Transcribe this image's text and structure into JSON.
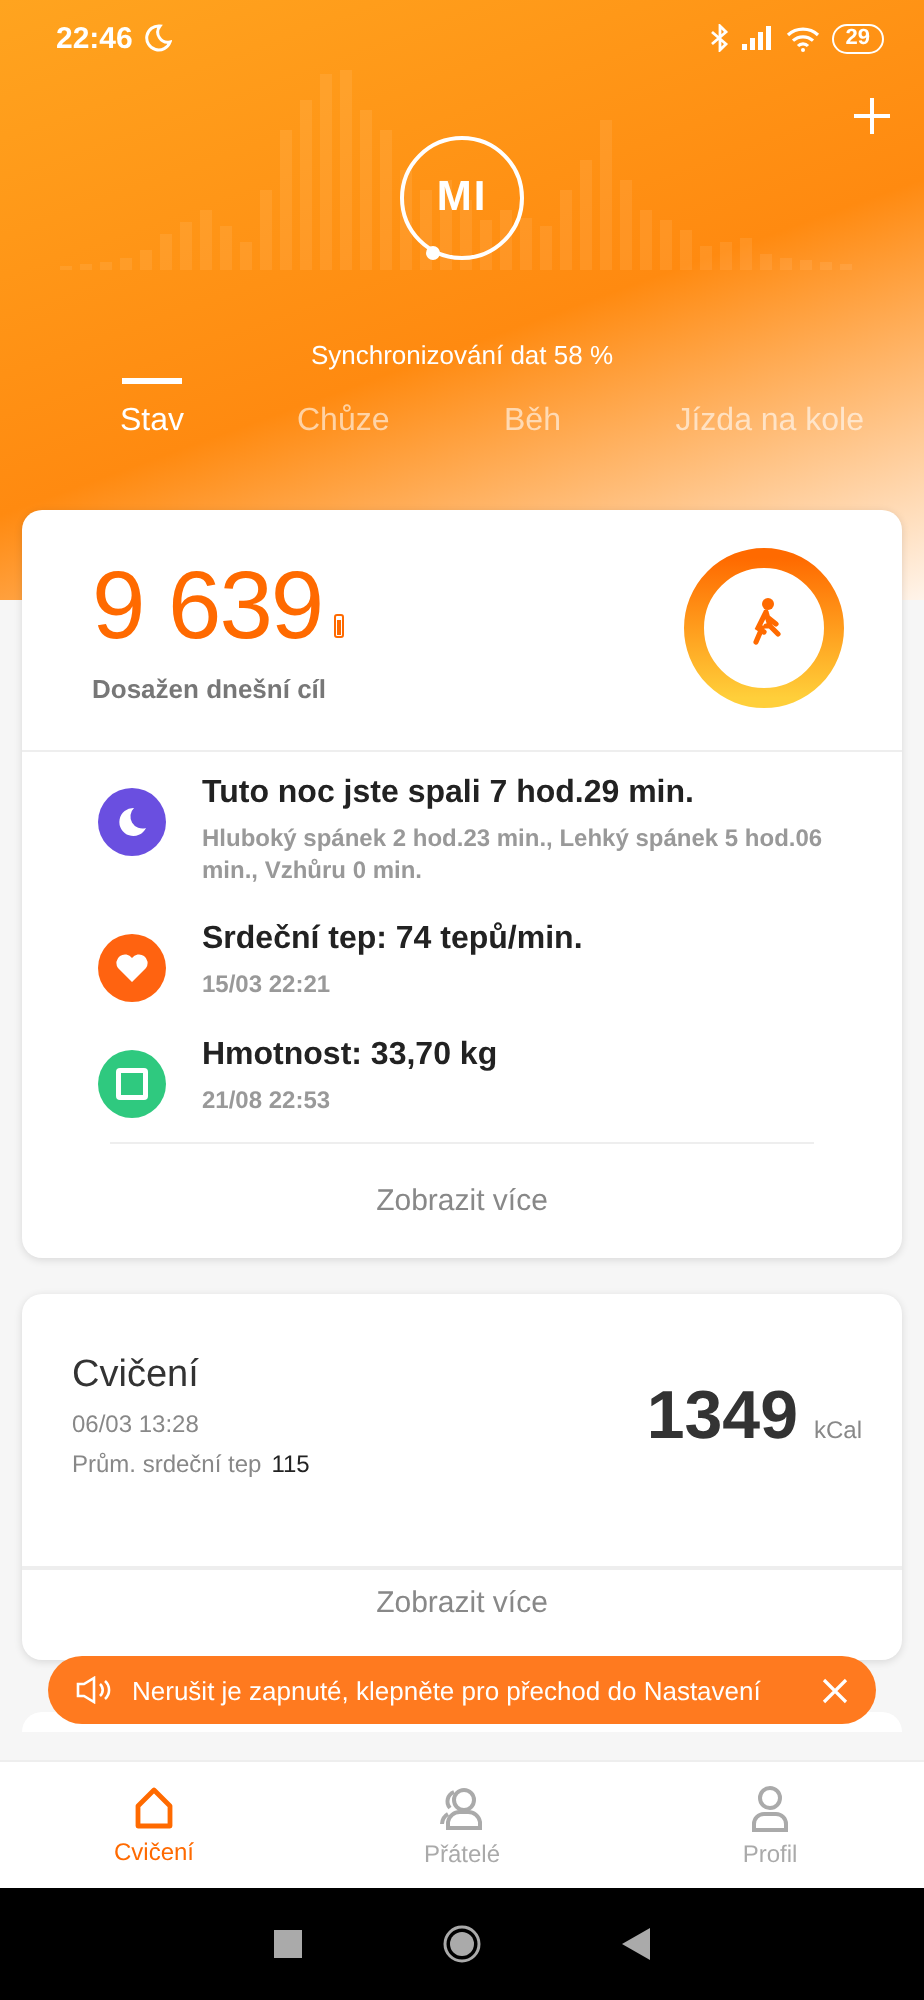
{
  "status_bar": {
    "time": "22:46",
    "battery": "29"
  },
  "header": {
    "logo": "MI",
    "sync_text": "Synchronizování dat 58 %"
  },
  "tabs": [
    {
      "label": "Stav",
      "selected": true
    },
    {
      "label": "Chůze",
      "selected": false
    },
    {
      "label": "Běh",
      "selected": false
    },
    {
      "label": "Jízda na kole",
      "selected": false
    }
  ],
  "steps_card": {
    "steps": "9 639",
    "goal_text": "Dosažen dnešní cíl",
    "items": [
      {
        "kind": "sleep",
        "color": "#6a4fe0",
        "title": "Tuto noc jste spali 7 hod.29 min.",
        "detail": "Hluboký spánek 2 hod.23 min., Lehký spánek 5 hod.06 min., Vzhůru 0 min."
      },
      {
        "kind": "heart",
        "color": "#ff6310",
        "title": "Srdeční tep: 74 tepů/min.",
        "detail": "15/03 22:21"
      },
      {
        "kind": "weight",
        "color": "#2fc97f",
        "title": "Hmotnost: 33,70 kg",
        "detail": "21/08 22:53"
      }
    ],
    "more": "Zobrazit více"
  },
  "workout_card": {
    "title": "Cvičení",
    "date": "06/03 13:28",
    "hr_label": "Prům. srdeční tep",
    "hr_value": "115",
    "calories": "1349",
    "unit": "kCal",
    "more": "Zobrazit více"
  },
  "toast": {
    "text": "Nerušit je zapnuté, klepněte pro přechod do Nastavení"
  },
  "bottom_nav": [
    {
      "kind": "home",
      "label": "Cvičení",
      "selected": true
    },
    {
      "kind": "friends",
      "label": "Přátelé",
      "selected": false
    },
    {
      "kind": "profile",
      "label": "Profil",
      "selected": false
    }
  ]
}
